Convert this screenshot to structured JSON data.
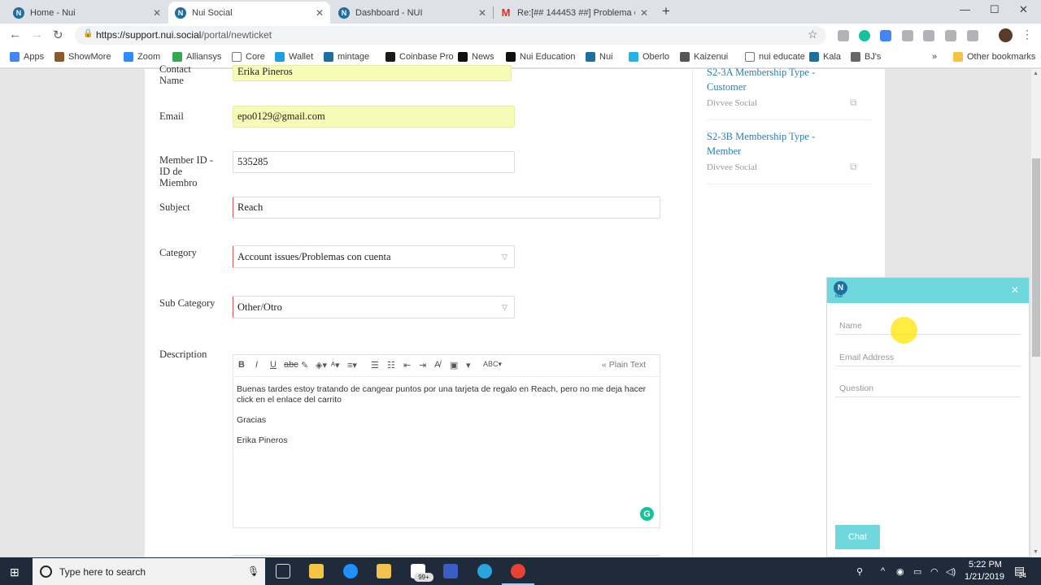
{
  "browser": {
    "tabs": [
      {
        "title": "Home - Nui",
        "icon": "nui-icon",
        "active": false
      },
      {
        "title": "Nui Social",
        "icon": "nui-icon",
        "active": true
      },
      {
        "title": "Dashboard - NUI",
        "icon": "nui-icon",
        "active": false
      },
      {
        "title": "Re:[## 144453 ##] Problema con",
        "icon": "gmail-icon",
        "active": false
      }
    ],
    "new_tab": "+",
    "url_host": "https://support.nui.social",
    "url_path": "/portal/newticket",
    "bookmarks": [
      {
        "label": "Apps",
        "color": "#4285f4"
      },
      {
        "label": "ShowMore",
        "color": "#8b5a2b"
      },
      {
        "label": "Zoom",
        "color": "#2d8cff"
      },
      {
        "label": "Alliansys",
        "color": "#34a853"
      },
      {
        "label": "Core",
        "color": "#ffffff"
      },
      {
        "label": "Wallet",
        "color": "#1ba1e2"
      },
      {
        "label": "mintage",
        "color": "#1e6fa0"
      },
      {
        "label": "Coinbase Pro",
        "color": "#1a1a1a"
      },
      {
        "label": "News",
        "color": "#111111"
      },
      {
        "label": "Nui Education",
        "color": "#111111"
      },
      {
        "label": "Nui",
        "color": "#1e6fa0"
      },
      {
        "label": "Oberlo",
        "color": "#25b3e6"
      },
      {
        "label": "Kaizenui",
        "color": "#555555"
      },
      {
        "label": "nui educate",
        "color": "#ffffff"
      },
      {
        "label": "Kala",
        "color": "#1e6fa0"
      },
      {
        "label": "BJ's",
        "color": "#666666"
      }
    ],
    "bookmarks_more": "»",
    "other_bookmarks": "Other bookmarks"
  },
  "form": {
    "contact_name_label": "Contact\nName",
    "contact_name_value": "Erika Pineros",
    "email_label": "Email",
    "email_value": "epo0129@gmail.com",
    "member_id_label": "Member ID -\nID de\nMiembro",
    "member_id_value": "535285",
    "subject_label": "Subject",
    "subject_value": "Reach",
    "category_label": "Category",
    "category_value": "Account issues/Problemas con cuenta",
    "subcategory_label": "Sub Category",
    "subcategory_value": "Other/Otro",
    "description_label": "Description",
    "editor_mode": "« Plain Text",
    "description_lines": [
      "Buenas tardes estoy tratando de cangear puntos por una tarjeta de regalo en Reach, pero no me deja hacer click en el enlace del carrito",
      "Gracias",
      "Erika Pineros"
    ]
  },
  "articles": [
    {
      "title": "S2-3A Membership Type - Customer",
      "source": "Divvee Social"
    },
    {
      "title": "S2-3B Membership Type - Member",
      "source": "Divvee Social"
    }
  ],
  "chat": {
    "brand": "nui",
    "name_placeholder": "Name",
    "email_placeholder": "Email Address",
    "question_placeholder": "Question",
    "button_label": "Chat"
  },
  "taskbar": {
    "search_placeholder": "Type here to search",
    "badge": "99+",
    "time": "5:22 PM",
    "date": "1/21/2019",
    "notification_count": "24"
  },
  "colors": {
    "accent": "#6ed8dc",
    "link": "#2a7fb0",
    "autofill": "#f8fbb5"
  }
}
